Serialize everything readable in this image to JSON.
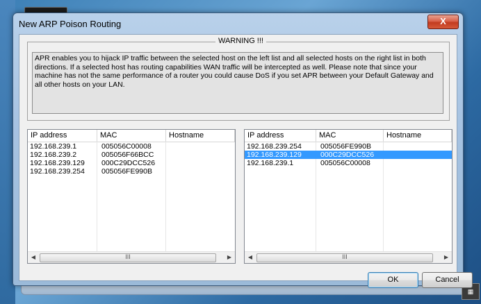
{
  "window": {
    "title": "New ARP Poison Routing",
    "close_glyph": "X"
  },
  "warning": {
    "legend": "WARNING !!!",
    "text": "APR enables you to hijack IP traffic between the selected host on the left list and all selected hosts on the right list in both directions. If a selected host has routing capabilities WAN traffic will be intercepted as well. Please note that since your machine has not the same performance of a router you could cause DoS if you set APR between your Default Gateway and all other hosts on your LAN."
  },
  "left_list": {
    "columns": [
      "IP address",
      "MAC",
      "Hostname"
    ],
    "rows": [
      {
        "ip": "192.168.239.1",
        "mac": "005056C00008",
        "host": ""
      },
      {
        "ip": "192.168.239.2",
        "mac": "005056F66BCC",
        "host": ""
      },
      {
        "ip": "192.168.239.129",
        "mac": "000C29DCC526",
        "host": ""
      },
      {
        "ip": "192.168.239.254",
        "mac": "005056FE990B",
        "host": ""
      }
    ],
    "scroll_grip": "III"
  },
  "right_list": {
    "columns": [
      "IP address",
      "MAC",
      "Hostname"
    ],
    "rows": [
      {
        "ip": "192.168.239.254",
        "mac": "005056FE990B",
        "host": "",
        "selected": false
      },
      {
        "ip": "192.168.239.129",
        "mac": "000C29DCC526",
        "host": "",
        "selected": true
      },
      {
        "ip": "192.168.239.1",
        "mac": "005056C00008",
        "host": "",
        "selected": false
      }
    ],
    "scroll_grip": "III"
  },
  "buttons": {
    "ok": "OK",
    "cancel": "Cancel"
  },
  "colors": {
    "selection": "#3399ff",
    "close_button": "#c23b20"
  },
  "icons": {
    "scroll_left": "arrow-left-icon",
    "scroll_right": "arrow-right-icon",
    "close": "close-icon"
  }
}
